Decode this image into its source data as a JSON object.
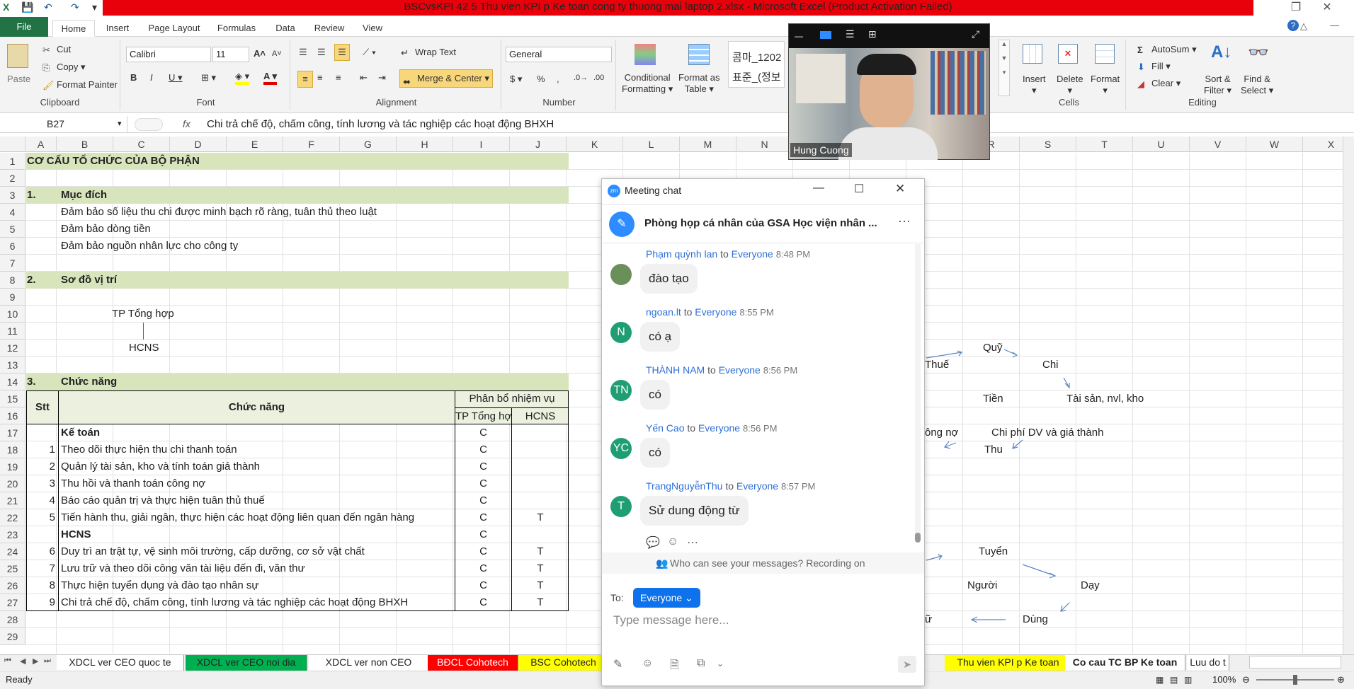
{
  "app": {
    "title": "BSCvsKPI 42 5 Thu vien KPI p Ke toan cong ty thuong mai laptop 2.xlsx  -  Microsoft Excel (Product Activation Failed)"
  },
  "tabs": [
    "File",
    "Home",
    "Insert",
    "Page Layout",
    "Formulas",
    "Data",
    "Review",
    "View"
  ],
  "ribbon": {
    "clipboard": {
      "label": "Clipboard",
      "paste": "Paste",
      "cut": "Cut",
      "copy": "Copy",
      "format_painter": "Format Painter"
    },
    "font": {
      "label": "Font",
      "name": "Calibri",
      "size": "11"
    },
    "alignment": {
      "label": "Alignment",
      "wrap": "Wrap Text",
      "merge": "Merge & Center"
    },
    "number": {
      "label": "Number",
      "format": "General"
    },
    "styles": {
      "conditional": "Conditional",
      "conditional2": "Formatting",
      "format_as": "Format as",
      "table": "Table",
      "style1": "콤마_1202",
      "style2": "표준_(정보"
    },
    "cells": {
      "label": "Cells",
      "insert": "Insert",
      "delete": "Delete",
      "format": "Format"
    },
    "editing": {
      "label": "Editing",
      "autosum": "AutoSum",
      "fill": "Fill",
      "clear": "Clear",
      "sort": "Sort &",
      "filter": "Filter",
      "find": "Find &",
      "select": "Select"
    }
  },
  "formula": {
    "namebox": "B27",
    "fx": "fx",
    "text": "Chi trả chế độ, chấm công, tính lương và tác nghiệp các hoạt động BHXH"
  },
  "columns": [
    "A",
    "B",
    "C",
    "D",
    "E",
    "F",
    "G",
    "H",
    "I",
    "J",
    "K",
    "L",
    "M",
    "N",
    "O",
    "P",
    "Q",
    "R",
    "S",
    "T",
    "U",
    "V",
    "W",
    "X"
  ],
  "rows": [
    "1",
    "2",
    "3",
    "4",
    "5",
    "6",
    "7",
    "8",
    "9",
    "10",
    "11",
    "12",
    "13",
    "14",
    "15",
    "16",
    "17",
    "18",
    "19",
    "20",
    "21",
    "22",
    "23",
    "24",
    "25",
    "26",
    "27",
    "28",
    "29"
  ],
  "sheet": {
    "r1": "CƠ CẤU TỔ CHỨC CỦA BỘ PHẬN",
    "r3a": "1.",
    "r3b": "Mục đích",
    "r4": "Đảm bảo số liệu thu chi được minh bạch rõ ràng, tuân thủ theo luật",
    "r5": "Đảm bảo dòng tiền",
    "r6": "Đảm bảo nguồn nhân lực cho công ty",
    "r8a": "2.",
    "r8b": "Sơ đồ vị trí",
    "r10": "TP Tổng hợp",
    "r12": "HCNS",
    "r14a": "3.",
    "r14b": "Chức năng",
    "hdr_stt": "Stt",
    "hdr_cn": "Chức năng",
    "hdr_pb": "Phân bổ nhiệm vụ",
    "hdr_tp": "TP Tổng hợp",
    "hdr_hcns": "HCNS",
    "table": [
      {
        "stt": "",
        "name": "Kế toán",
        "tp": "C",
        "hc": "",
        "bold": true
      },
      {
        "stt": "1",
        "name": "Theo dõi thực hiện thu chi thanh toán",
        "tp": "C",
        "hc": ""
      },
      {
        "stt": "2",
        "name": "Quản lý tài sản, kho và tính toán giá thành",
        "tp": "C",
        "hc": ""
      },
      {
        "stt": "3",
        "name": "Thu hồi và thanh toán công nợ",
        "tp": "C",
        "hc": ""
      },
      {
        "stt": "4",
        "name": "Báo cáo quản trị và thực hiện tuân thủ thuế",
        "tp": "C",
        "hc": ""
      },
      {
        "stt": "5",
        "name": "Tiến hành thu, giải ngân, thực hiện các hoạt động liên quan đến ngân hàng",
        "tp": "C",
        "hc": "T"
      },
      {
        "stt": "",
        "name": "HCNS",
        "tp": "C",
        "hc": "",
        "bold": true
      },
      {
        "stt": "6",
        "name": "Duy trì an trật tự, vệ sinh môi trường, cấp dưỡng, cơ sở vật chất",
        "tp": "C",
        "hc": "T"
      },
      {
        "stt": "7",
        "name": "Lưu trữ và theo dõi công văn tài liệu đến đi, văn thư",
        "tp": "C",
        "hc": "T"
      },
      {
        "stt": "8",
        "name": "Thực hiện tuyển dụng và đào tạo nhân sự",
        "tp": "C",
        "hc": "T"
      },
      {
        "stt": "9",
        "name": "Chi trả chế độ, chấm công, tính lương và tác nghiệp các hoạt động BHXH",
        "tp": "C",
        "hc": "T"
      }
    ],
    "diagram": {
      "quy": "Quỹ",
      "thue": "Thuế",
      "chi": "Chi",
      "tien": "Tiền",
      "taisan": "Tài sản, nvl, kho",
      "congno": "ông nợ",
      "chiphi": "Chi phí DV và giá thành",
      "thu": "Thu",
      "tuyen": "Tuyển",
      "nguoi": "Người",
      "day": "Dạy",
      "dung": "Dùng",
      "tr": "ữ"
    }
  },
  "sheettabs": [
    "XDCL ver CEO quoc te",
    "XDCL ver CEO noi dia",
    "XDCL ver non CEO",
    "BĐCL Cohotech",
    "BSC Cohotech",
    "Thu vien KPI p Ke toan",
    "Co cau TC BP Ke toan",
    "Luu do t"
  ],
  "sheettab_colors": [
    "#ffffff",
    "#00b050",
    "#ffffff",
    "#ff0000",
    "#ffff00",
    "#ffff00",
    "#ffffff",
    "#ffffff"
  ],
  "status": {
    "ready": "Ready",
    "zoom": "100%"
  },
  "video": {
    "name": "Hung Cuong"
  },
  "chat": {
    "title": "Meeting chat",
    "room": "Phòng họp cá nhân của GSA Học viện nhân ...",
    "messages": [
      {
        "name": "Phạm quỳnh lan",
        "to": "to",
        "target": "Everyone",
        "time": "8:48 PM",
        "text": "đào tạo",
        "avatar": "",
        "color": "#6b8f5a"
      },
      {
        "name": "ngoan.lt",
        "to": "to",
        "target": "Everyone",
        "time": "8:55 PM",
        "text": "có ạ",
        "avatar": "N",
        "color": "#1f9e73"
      },
      {
        "name": "THÀNH NAM",
        "to": "to",
        "target": "Everyone",
        "time": "8:56 PM",
        "text": "có",
        "avatar": "TN",
        "color": "#1f9e73"
      },
      {
        "name": "Yến Cao",
        "to": "to",
        "target": "Everyone",
        "time": "8:56 PM",
        "text": "có",
        "avatar": "YC",
        "color": "#1f9e73"
      },
      {
        "name": "TrangNguyễnThu",
        "to": "to",
        "target": "Everyone",
        "time": "8:57 PM",
        "text": "Sử dung động từ",
        "avatar": "T",
        "color": "#1f9e73"
      }
    ],
    "privacy": "Who can see your messages? Recording on",
    "to_label": "To:",
    "recipient": "Everyone",
    "placeholder": "Type message here..."
  }
}
